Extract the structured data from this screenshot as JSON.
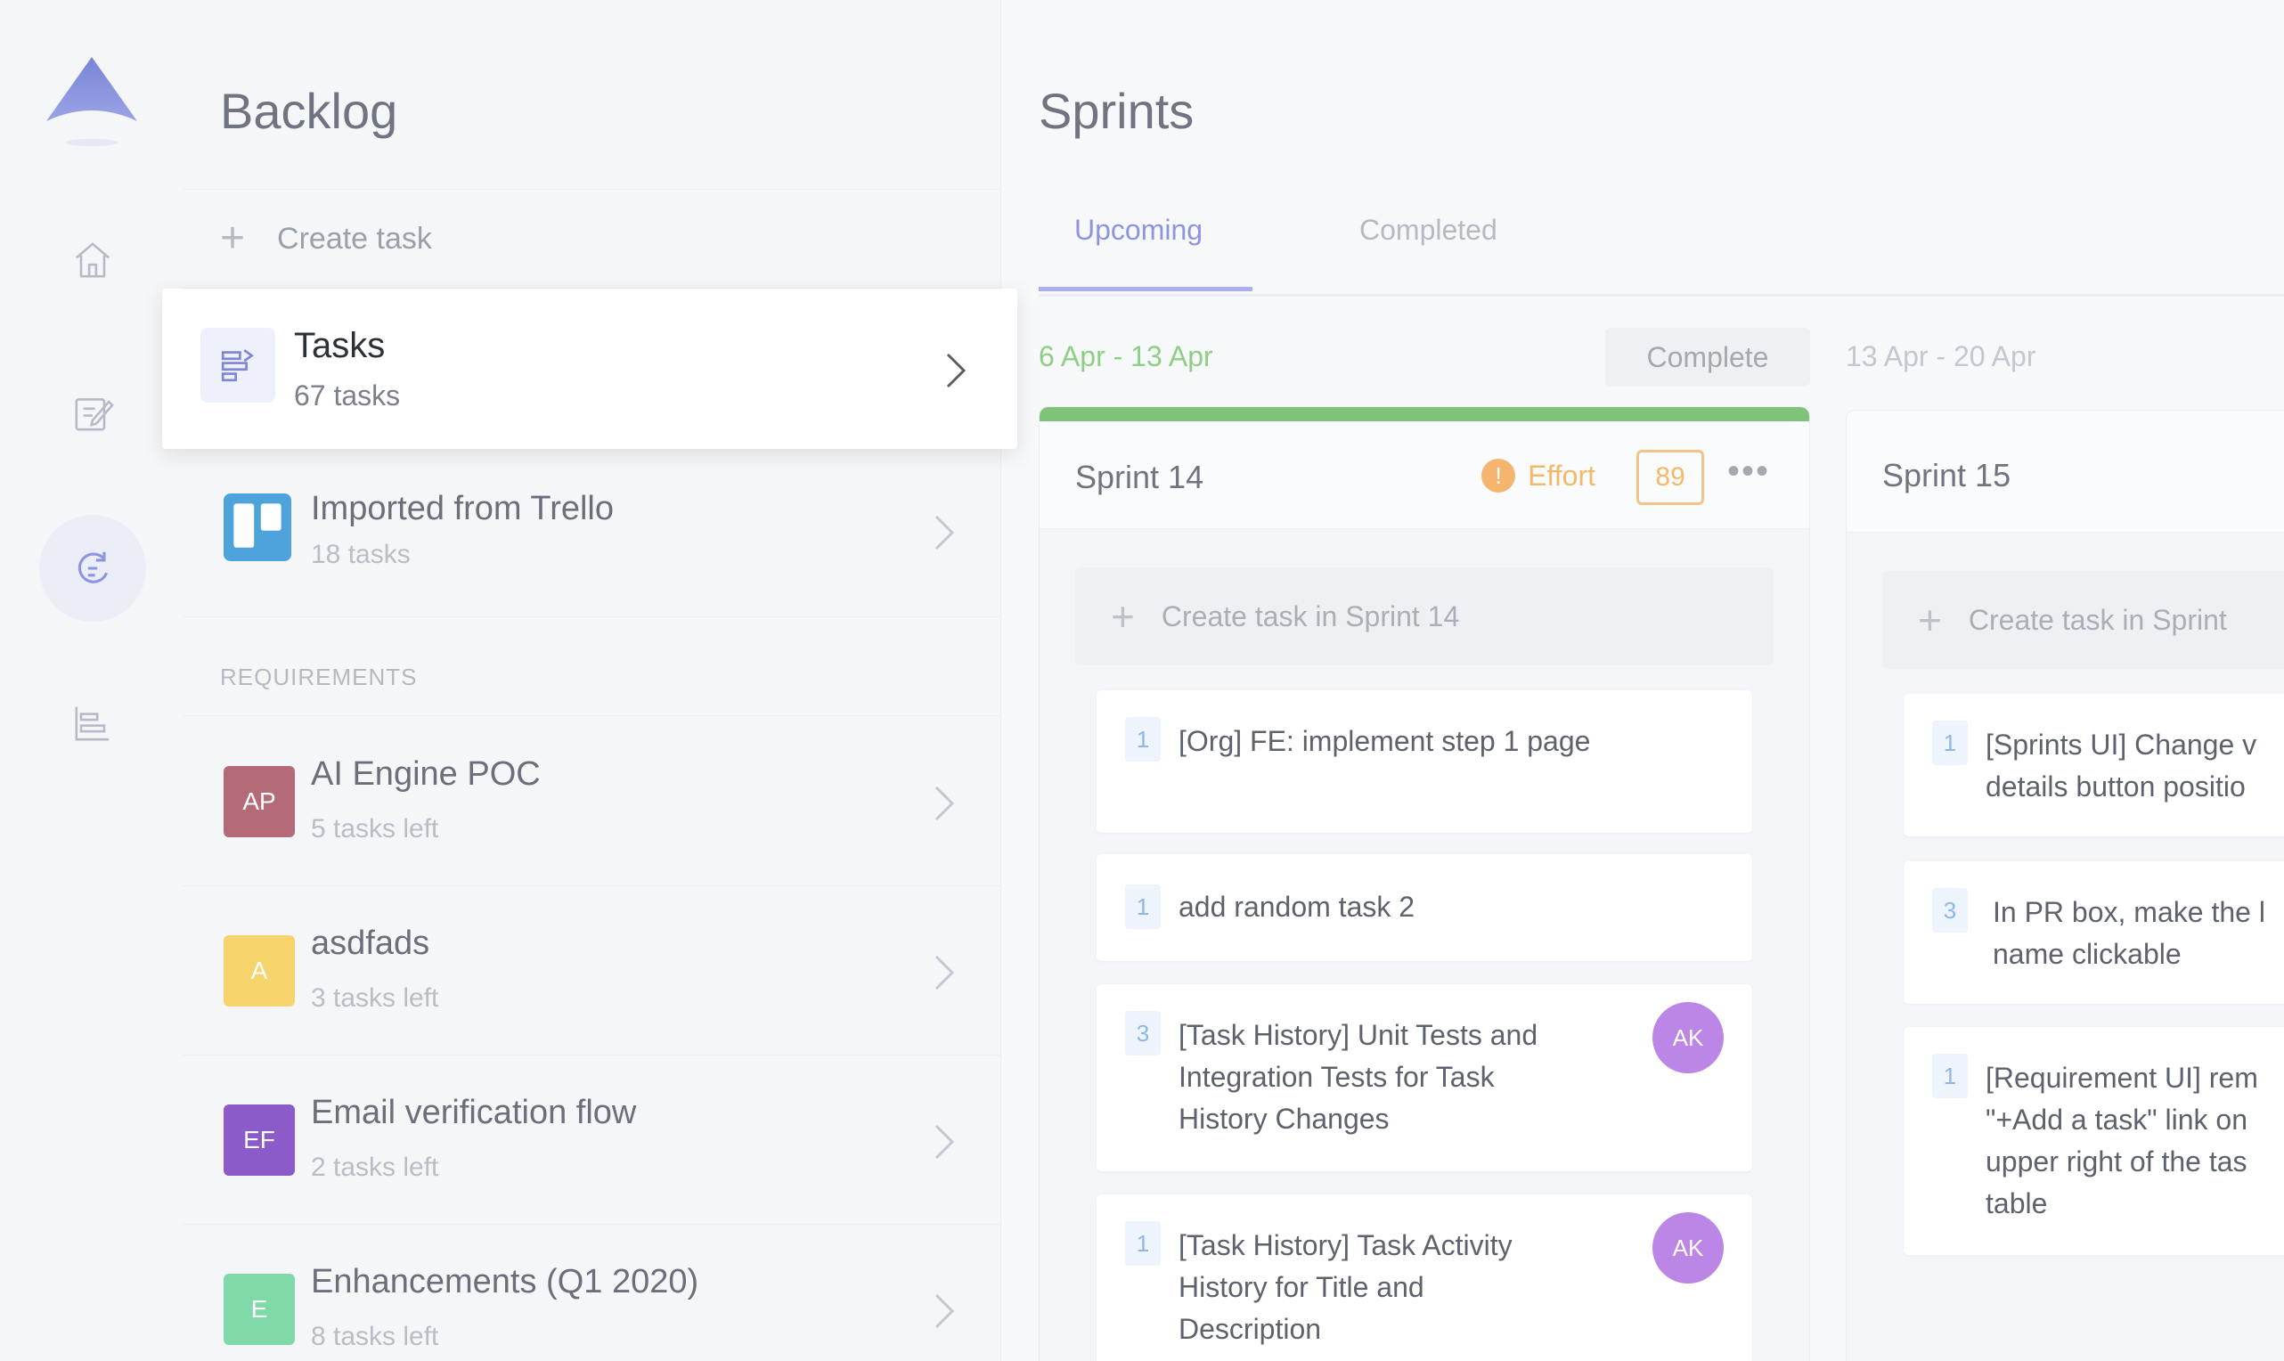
{
  "backlog": {
    "title": "Backlog",
    "create_label": "Create task",
    "tasks_card": {
      "title": "Tasks",
      "count": "67 tasks"
    },
    "trello": {
      "title": "Imported from Trello",
      "count": "18 tasks"
    },
    "requirements_label": "REQUIREMENTS",
    "requirements": [
      {
        "badge": "AP",
        "title": "AI Engine POC",
        "sub": "5 tasks left",
        "color": "#b56a78"
      },
      {
        "badge": "A",
        "title": "asdfads",
        "sub": "3 tasks left",
        "color": "#f7d36b"
      },
      {
        "badge": "EF",
        "title": "Email verification flow",
        "sub": "2 tasks left",
        "color": "#8a5bc9"
      },
      {
        "badge": "E",
        "title": "Enhancements (Q1 2020)",
        "sub": "8 tasks left",
        "color": "#7fd9a8"
      }
    ]
  },
  "sprints": {
    "title": "Sprints",
    "tabs": [
      {
        "label": "Upcoming",
        "active": true
      },
      {
        "label": "Completed",
        "active": false
      }
    ],
    "range_current": "6 Apr - 13 Apr",
    "range_next": "13 Apr - 20 Apr",
    "complete_label": "Complete",
    "columns": [
      {
        "name": "Sprint 14",
        "effort_label": "Effort",
        "effort_value": "89",
        "create_label": "Create task in Sprint 14",
        "cards": [
          {
            "points": "1",
            "text": "[Org] FE: implement step 1 page",
            "avatar": ""
          },
          {
            "points": "1",
            "text": "add random task 2",
            "avatar": ""
          },
          {
            "points": "3",
            "text": "[Task History] Unit Tests and Integration Tests for Task History Changes",
            "avatar": "AK"
          },
          {
            "points": "1",
            "text": "[Task History] Task Activity History for Title and Description",
            "avatar": "AK"
          }
        ]
      },
      {
        "name": "Sprint 15",
        "create_label": "Create task in Sprint",
        "cards": [
          {
            "points": "1",
            "text": "[Sprints UI] Change v details button positio"
          },
          {
            "points": "3",
            "text": "In PR box, make the l name clickable"
          },
          {
            "points": "1",
            "text": "[Requirement UI] rem \"+Add a task\" link on upper right of the tas table"
          }
        ]
      }
    ]
  },
  "colors": {
    "accent": "#8e95e0",
    "sprint_bar": "#7fc37a",
    "range_current": "#8fcf85",
    "effort": "#f2b96a"
  }
}
